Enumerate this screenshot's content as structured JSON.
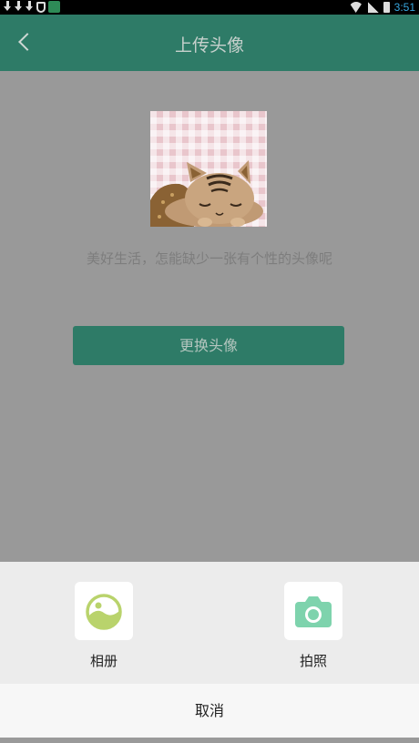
{
  "status_bar": {
    "time": "3:51"
  },
  "header": {
    "title": "上传头像"
  },
  "main": {
    "slogan": "美好生活，怎能缺少一张有个性的头像呢",
    "change_button": "更换头像"
  },
  "sheet": {
    "options": [
      {
        "label": "相册",
        "icon": "album-icon"
      },
      {
        "label": "拍照",
        "icon": "camera-icon"
      }
    ],
    "cancel": "取消"
  },
  "colors": {
    "primary": "#2e7b67",
    "overlay": "#999999",
    "album_icon": "#b9d36c",
    "camera_icon": "#7ed3ad"
  }
}
